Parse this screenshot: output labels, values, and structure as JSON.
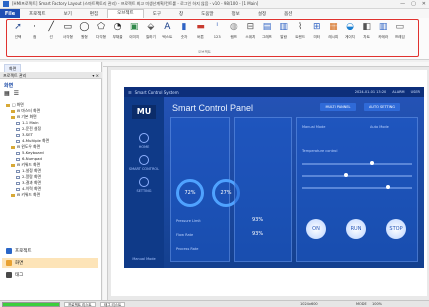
{
  "window": {
    "title": "[HMI프로젝트] Smart Factory Layout (스마트팩토리 관리) - 프로젝트 최고 미생산계획/컨트롤 - 로그인 하지 않음 - v10 - 98/100 - [1 Main]",
    "min_icon": "minimize-icon",
    "max_icon": "maximize-icon",
    "close_icon": "close-icon"
  },
  "menubar": {
    "file": "File",
    "items": [
      "프로젝트",
      "보기",
      "편집",
      "오브젝트",
      "도구",
      "창",
      "도움말",
      "정보",
      "설정",
      "옵션"
    ]
  },
  "ribbon": {
    "tools": [
      {
        "icon": "pointer-icon",
        "label": "선택",
        "glyph": "➚",
        "color": "#2c4f93"
      },
      {
        "icon": "dot-icon",
        "label": "점",
        "glyph": "·",
        "color": "#222"
      },
      {
        "icon": "line-icon",
        "label": "선",
        "glyph": "╱",
        "color": "#222"
      },
      {
        "icon": "rectangle-icon",
        "label": "사각형",
        "glyph": "▭",
        "color": "#222"
      },
      {
        "icon": "circle-icon",
        "label": "원형",
        "glyph": "◯",
        "color": "#222"
      },
      {
        "icon": "polygon-icon",
        "label": "다각형",
        "glyph": "⬠",
        "color": "#222"
      },
      {
        "icon": "arc-icon",
        "label": "부채꼴",
        "glyph": "◔",
        "color": "#222"
      },
      {
        "icon": "image-icon",
        "label": "이미지",
        "glyph": "▣",
        "color": "#2f8a4a"
      },
      {
        "icon": "fill-icon",
        "label": "칠하기",
        "glyph": "⬙",
        "color": "#555"
      },
      {
        "icon": "text-icon",
        "label": "텍스트",
        "glyph": "A",
        "color": "#1a3f8a"
      },
      {
        "icon": "numeric-icon",
        "label": "숫자",
        "glyph": "▮",
        "color": "#2f63c4"
      },
      {
        "icon": "button-icon",
        "label": "버튼",
        "glyph": "▬",
        "color": "#c83b2f"
      },
      {
        "icon": "input-icon",
        "label": "123",
        "glyph": "ⁱ",
        "color": "#2b57b8"
      },
      {
        "icon": "lamp-icon",
        "label": "램프",
        "glyph": "◍",
        "color": "#8a8a8a"
      },
      {
        "icon": "switch-icon",
        "label": "스위치",
        "glyph": "⊟",
        "color": "#555"
      },
      {
        "icon": "graph-icon",
        "label": "그래프",
        "glyph": "▤",
        "color": "#2f63c4"
      },
      {
        "icon": "alarm-icon",
        "label": "알람",
        "glyph": "▥",
        "color": "#2f63c4"
      },
      {
        "icon": "trend-icon",
        "label": "트렌드",
        "glyph": "⌇",
        "color": "#555"
      },
      {
        "icon": "meter-icon",
        "label": "미터",
        "glyph": "⊞",
        "color": "#2f63c4"
      },
      {
        "icon": "recipe-icon",
        "label": "레시피",
        "glyph": "▦",
        "color": "#d66e1e"
      },
      {
        "icon": "gauge-icon",
        "label": "게이지",
        "glyph": "◒",
        "color": "#1a7fd1"
      },
      {
        "icon": "chart-icon",
        "label": "차트",
        "glyph": "◧",
        "color": "#555"
      },
      {
        "icon": "camera-icon",
        "label": "카메라",
        "glyph": "▥",
        "color": "#2f63c4"
      },
      {
        "icon": "frame-icon",
        "label": "프레임",
        "glyph": "▭",
        "color": "#555"
      }
    ],
    "group_label": "오브젝트"
  },
  "left_panel": {
    "tab": "화면",
    "header": "프로젝트 관리",
    "pin": "▾ ×",
    "screen_label": "화면",
    "tree": [
      {
        "indent": 0,
        "label": "□ 화면",
        "type": "folder"
      },
      {
        "indent": 1,
        "label": "⊟ 마스터 화면",
        "type": "folder"
      },
      {
        "indent": 1,
        "label": "⊟ 기본 화면",
        "type": "folder"
      },
      {
        "indent": 2,
        "label": "1-1 Main",
        "type": "page"
      },
      {
        "indent": 2,
        "label": "2-운전 설정",
        "type": "page"
      },
      {
        "indent": 2,
        "label": "3-SET",
        "type": "page"
      },
      {
        "indent": 2,
        "label": "4-Multiple 화면",
        "type": "page"
      },
      {
        "indent": 1,
        "label": "⊟ 윈도우 화면",
        "type": "folder"
      },
      {
        "indent": 2,
        "label": "5-Keyboard",
        "type": "page"
      },
      {
        "indent": 2,
        "label": "6-Numpad",
        "type": "page"
      },
      {
        "indent": 1,
        "label": "⊟ 키워드 화면",
        "type": "folder"
      },
      {
        "indent": 2,
        "label": "1-설정 화면",
        "type": "page"
      },
      {
        "indent": 2,
        "label": "2-알람 화면",
        "type": "page"
      },
      {
        "indent": 2,
        "label": "3-결과 화면",
        "type": "page"
      },
      {
        "indent": 2,
        "label": "4-이력 화면",
        "type": "page"
      },
      {
        "indent": 1,
        "label": "⊟ 키워드 화면",
        "type": "folder"
      }
    ],
    "bottom": [
      {
        "label": "프로젝트",
        "color": "#2a66c7"
      },
      {
        "label": "화면",
        "color": "#e8a132"
      },
      {
        "label": "태그",
        "color": "#4a4a4a"
      }
    ]
  },
  "hmi": {
    "system_name": "Smart Control System",
    "top_right": [
      "2024-01-01  13:20",
      "ALARM",
      "USER"
    ],
    "logo": "MU",
    "side_items": [
      "HOME",
      "SMART CONTROL",
      "SETTING",
      "Manual Mode"
    ],
    "title": "Smart Control Panel",
    "btn_multi": "MULTI PANNEL",
    "btn_auto": "AUTO SETTING",
    "gauge1": "72%",
    "gauge2": "27%",
    "label_pressure": "Pressure Limit",
    "value_pressure": "93%",
    "label_rate": "Flow Rate",
    "value_rate": "93%",
    "label_process": "Process Rate",
    "label_manual": "Manual Mode",
    "label_auto": "Auto Mode",
    "label_temperature": "Temperature control",
    "round1": "ON",
    "round2": "RUN",
    "round3": "STOP"
  },
  "status": {
    "progress_pct": 100,
    "tabs": [
      "프로젝트 리스트",
      "태그 리스트"
    ],
    "coord": "1024x600",
    "mode": "MODE",
    "zoom": "100%"
  }
}
